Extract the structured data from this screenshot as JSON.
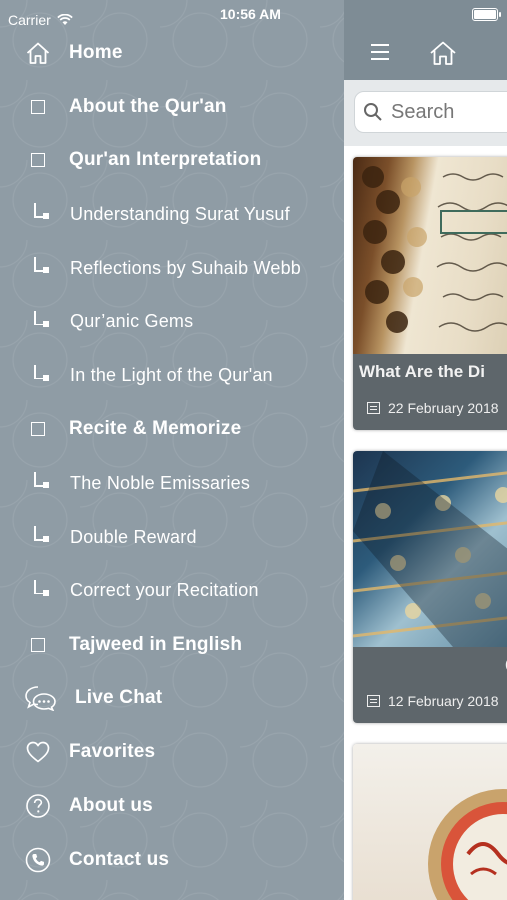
{
  "status_bar": {
    "carrier": "Carrier",
    "time": "10:56 AM"
  },
  "menu": {
    "items": [
      {
        "label": "Home",
        "icon": "home-icon",
        "type": "main"
      },
      {
        "label": "About the Qur'an",
        "icon": "square-icon",
        "type": "main"
      },
      {
        "label": "Qur'an Interpretation",
        "icon": "square-icon",
        "type": "main"
      },
      {
        "label": "Understanding Surat Yusuf",
        "icon": "sub-item-icon",
        "type": "sub"
      },
      {
        "label": "Reflections by Suhaib Webb",
        "icon": "sub-item-icon",
        "type": "sub"
      },
      {
        "label": "Qur’anic Gems",
        "icon": "sub-item-icon",
        "type": "sub"
      },
      {
        "label": "In the Light of the Qur'an",
        "icon": "sub-item-icon",
        "type": "sub"
      },
      {
        "label": "Recite & Memorize",
        "icon": "square-icon",
        "type": "main"
      },
      {
        "label": "The Noble Emissaries",
        "icon": "sub-item-icon",
        "type": "sub"
      },
      {
        "label": "Double Reward",
        "icon": "sub-item-icon",
        "type": "sub"
      },
      {
        "label": "Correct your Recitation",
        "icon": "sub-item-icon",
        "type": "sub"
      },
      {
        "label": "Tajweed in English",
        "icon": "square-icon",
        "type": "main"
      },
      {
        "label": "Live Chat",
        "icon": "chat-icon",
        "type": "main"
      },
      {
        "label": "Favorites",
        "icon": "heart-icon",
        "type": "main"
      },
      {
        "label": "About us",
        "icon": "question-icon",
        "type": "main"
      },
      {
        "label": "Contact us",
        "icon": "phone-icon",
        "type": "main"
      }
    ]
  },
  "search": {
    "placeholder": "Search"
  },
  "cards": [
    {
      "title": "What Are the Di",
      "date": "22 February 2018",
      "image": "quran-prayer-beads-image"
    },
    {
      "title": "Ca",
      "date": "12 February 2018",
      "image": "mosque-tiles-image"
    },
    {
      "title": "",
      "date": "",
      "image": "calligraphy-plate-image"
    }
  ],
  "colors": {
    "drawer": "#8f9ca5",
    "topbar": "#7e8c95",
    "caption": "#5e666b"
  }
}
